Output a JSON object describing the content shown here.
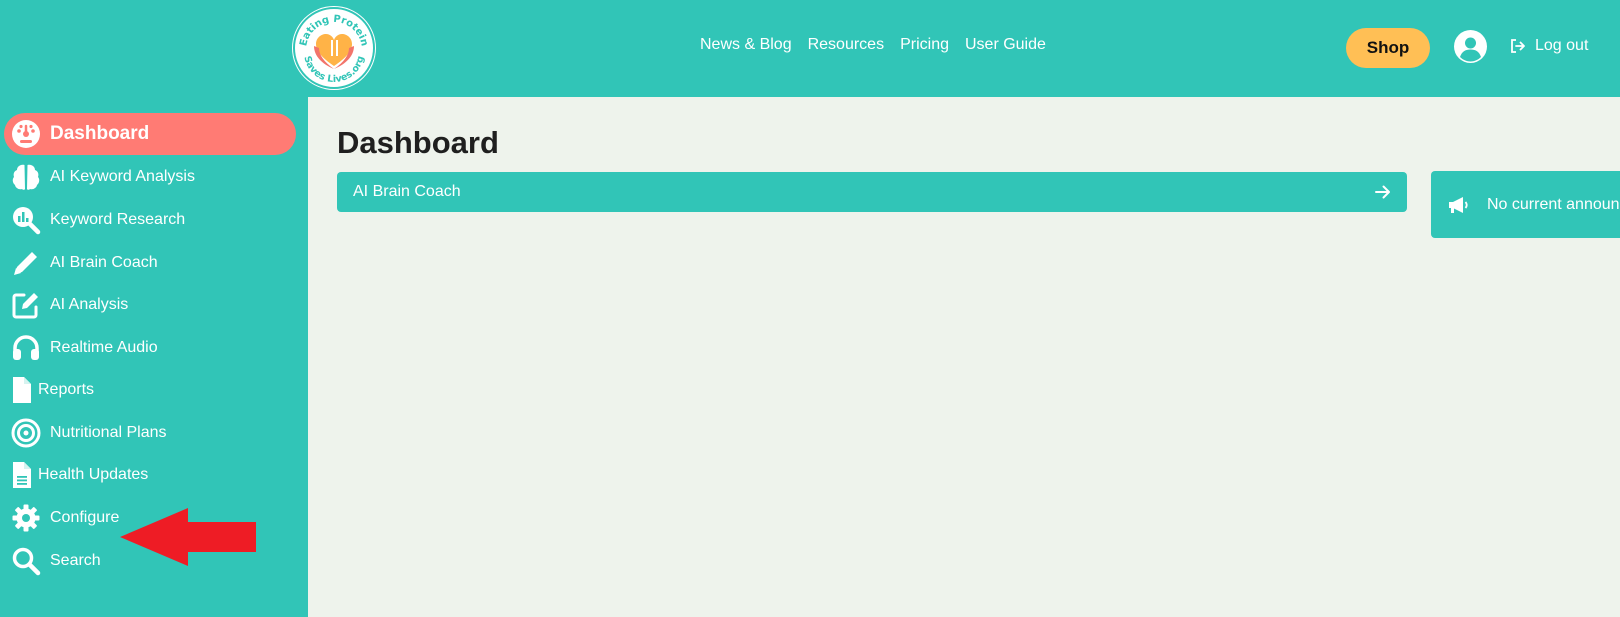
{
  "logo": {
    "top_text": "Eating Protein",
    "bottom_text": "Saves Lives.org"
  },
  "nav": {
    "items": [
      "News & Blog",
      "Resources",
      "Pricing",
      "User Guide"
    ]
  },
  "header": {
    "shop_label": "Shop",
    "logout_label": "Log out"
  },
  "sidebar": {
    "items": [
      {
        "label": "Dashboard",
        "icon": "gauge-icon",
        "active": true
      },
      {
        "label": "AI Keyword Analysis",
        "icon": "brain-icon"
      },
      {
        "label": "Keyword Research",
        "icon": "search-chart-icon"
      },
      {
        "label": "AI Brain Coach",
        "icon": "pencil-icon"
      },
      {
        "label": "AI Analysis",
        "icon": "edit-square-icon"
      },
      {
        "label": "Realtime Audio",
        "icon": "headphones-icon"
      },
      {
        "label": "Reports",
        "icon": "file-icon"
      },
      {
        "label": "Nutritional Plans",
        "icon": "target-icon"
      },
      {
        "label": "Health Updates",
        "icon": "file-text-icon"
      },
      {
        "label": "Configure",
        "icon": "gear-icon"
      },
      {
        "label": "Search",
        "icon": "search-icon"
      }
    ]
  },
  "main": {
    "title": "Dashboard",
    "coach_card_label": "AI Brain Coach",
    "announcement_text": "No current announ"
  },
  "colors": {
    "teal": "#31c5b7",
    "active_item": "#ff7b74",
    "shop_button": "#ffbf55",
    "background": "#eef3ec",
    "annotation_arrow": "#ee1c25"
  }
}
